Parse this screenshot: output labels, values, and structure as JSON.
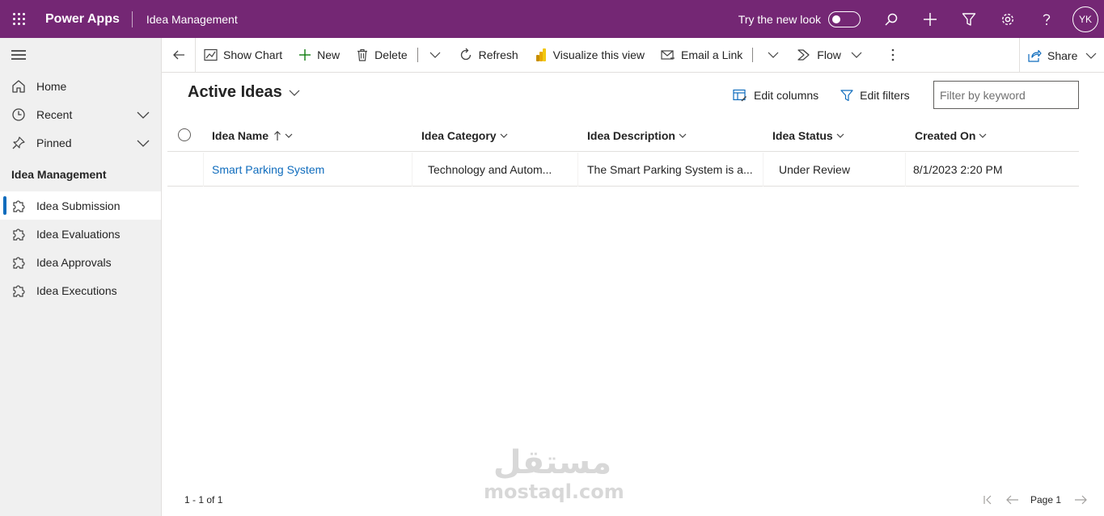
{
  "header": {
    "brand": "Power Apps",
    "app_name": "Idea Management",
    "try_new_look": "Try the new look",
    "toggle_on": false,
    "avatar_initials": "YK",
    "icons": [
      "waffle-icon",
      "search-icon",
      "plus-icon",
      "filter-icon",
      "settings-icon",
      "help-icon"
    ]
  },
  "sidebar": {
    "items": [
      {
        "label": "Home",
        "icon": "home-icon"
      },
      {
        "label": "Recent",
        "icon": "clock-icon"
      },
      {
        "label": "Pinned",
        "icon": "pin-icon"
      }
    ],
    "group_title": "Idea Management",
    "group_items": [
      {
        "label": "Idea Submission",
        "icon": "puzzle-icon",
        "selected": true
      },
      {
        "label": "Idea Evaluations",
        "icon": "puzzle-icon"
      },
      {
        "label": "Idea Approvals",
        "icon": "puzzle-icon"
      },
      {
        "label": "Idea Executions",
        "icon": "puzzle-icon"
      }
    ]
  },
  "commands": {
    "show_chart": "Show Chart",
    "new": "New",
    "delete": "Delete",
    "refresh": "Refresh",
    "visualize": "Visualize this view",
    "email_link": "Email a Link",
    "flow": "Flow",
    "share": "Share"
  },
  "view": {
    "title": "Active Ideas",
    "edit_columns": "Edit columns",
    "edit_filters": "Edit filters",
    "filter_placeholder": "Filter by keyword"
  },
  "grid": {
    "columns": [
      "Idea Name",
      "Idea Category",
      "Idea Description",
      "Idea Status",
      "Created On"
    ],
    "rows": [
      {
        "name": "Smart Parking System",
        "category": "Technology and Autom...",
        "description": "The Smart Parking System is a...",
        "status": "Under Review",
        "created_on": "8/1/2023 2:20 PM"
      }
    ]
  },
  "footer": {
    "record_count": "1 - 1 of 1",
    "page_label": "Page 1"
  },
  "watermark": {
    "arabic": "مستقل",
    "latin": "mostaql.com"
  },
  "colors": {
    "header_bg": "#742774",
    "link": "#0f6cbd",
    "selected_bar": "#0f6cbd"
  }
}
